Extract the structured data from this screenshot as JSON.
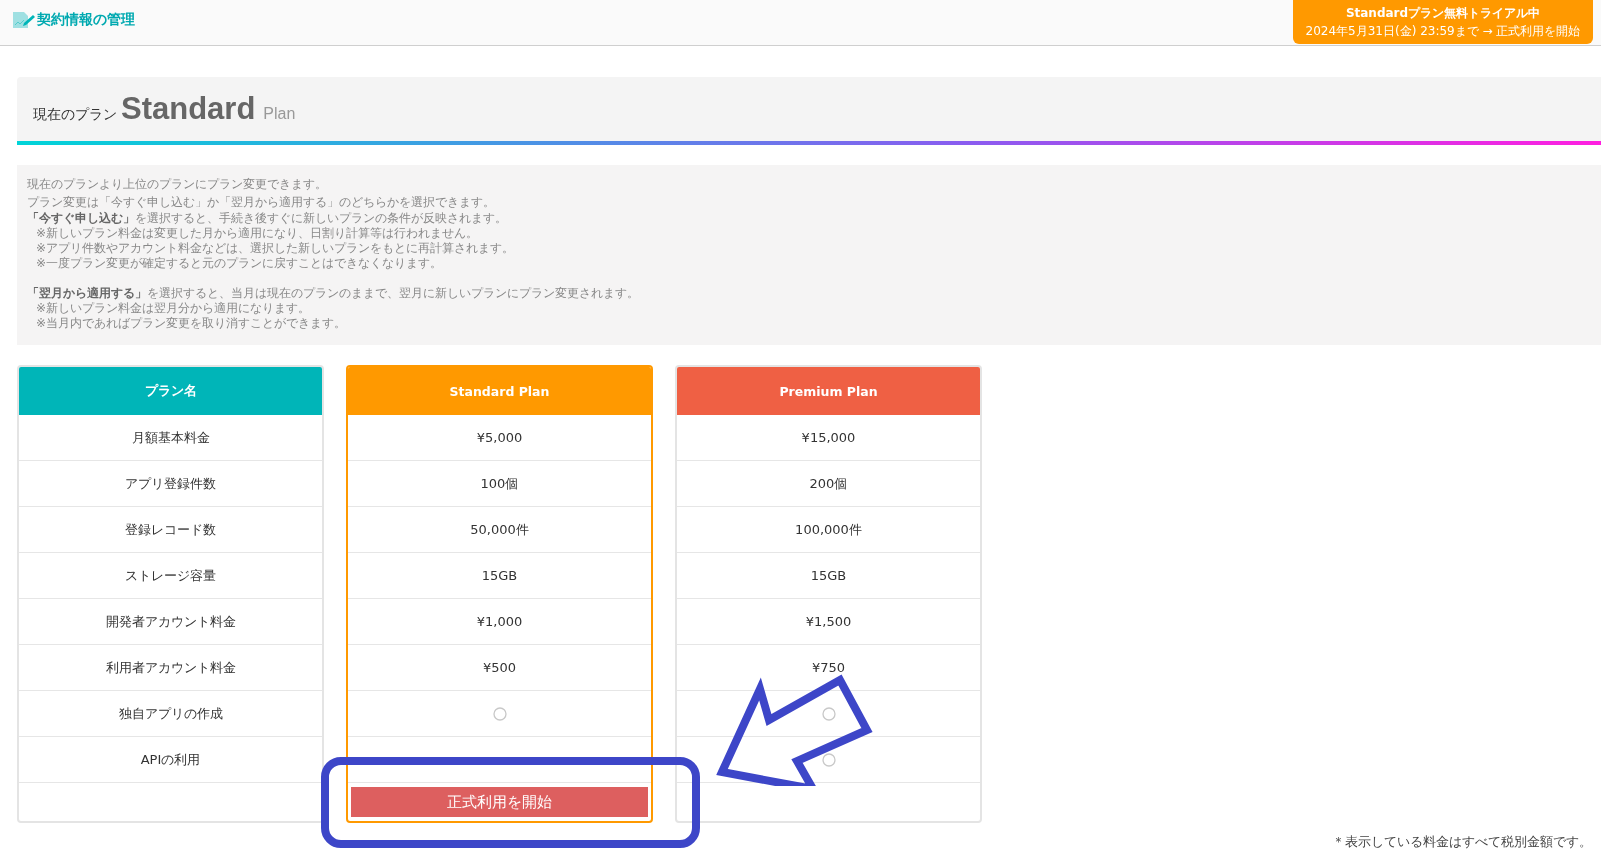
{
  "header": {
    "title": "契約情報の管理",
    "trial": {
      "title": "Standardプラン無料トライアル中",
      "subtitle": "2024年5月31日(金) 23:59まで → 正式利用を開始"
    }
  },
  "current_plan": {
    "label": "現在のプラン",
    "name": "Standard",
    "suffix": "Plan"
  },
  "info": {
    "intro": [
      "現在のプランより上位のプランにプラン変更できます。",
      "プラン変更は「今すぐ申し込む」か「翌月から適用する」のどちらかを選択できます。"
    ],
    "sections": [
      {
        "lead": "**「今すぐ申し込む」**を選択すると、手続き後すぐに新しいプランの条件が反映されます。",
        "notes": [
          "※新しいプラン料金は変更した月から適用になり、日割り計算等は行われません。",
          "※アプリ件数やアカウント料金などは、選択した新しいプランをもとに再計算されます。",
          "※一度プラン変更が確定すると元のプランに戻すことはできなくなります。"
        ]
      },
      {
        "lead": "**「翌月から適用する」**を選択すると、当月は現在のプランのままで、翌月に新しいプランにプラン変更されます。",
        "notes": [
          "※新しいプラン料金は翌月分から適用になります。",
          "※当月内であればプラン変更を取り消すことができます。"
        ]
      }
    ]
  },
  "columns": [
    {
      "kind": "labels",
      "header": "プラン名",
      "current": false,
      "cells": [
        {
          "text": "月額基本料金"
        },
        {
          "text": "アプリ登録件数"
        },
        {
          "text": "登録レコード数"
        },
        {
          "text": "ストレージ容量"
        },
        {
          "text": "開発者アカウント料金"
        },
        {
          "text": "利用者アカウント料金"
        },
        {
          "text": "独自アプリの作成"
        },
        {
          "text": "APIの利用"
        }
      ]
    },
    {
      "kind": "plan",
      "header": "Standard Plan",
      "current": true,
      "cells": [
        {
          "text": "¥5,000"
        },
        {
          "text": "100個"
        },
        {
          "text": "50,000件"
        },
        {
          "text": "15GB"
        },
        {
          "text": "¥1,000"
        },
        {
          "text": "¥500"
        },
        {
          "included": true
        },
        {
          "included": false
        }
      ],
      "button": "正式利用を開始"
    },
    {
      "kind": "plan",
      "header": "Premium Plan",
      "current": false,
      "cells": [
        {
          "text": "¥15,000"
        },
        {
          "text": "200個"
        },
        {
          "text": "100,000件"
        },
        {
          "text": "15GB"
        },
        {
          "text": "¥1,500"
        },
        {
          "text": "¥750"
        },
        {
          "included": true
        },
        {
          "included": true
        }
      ]
    }
  ],
  "footnote": "＊表示している料金はすべて税別金額です。"
}
